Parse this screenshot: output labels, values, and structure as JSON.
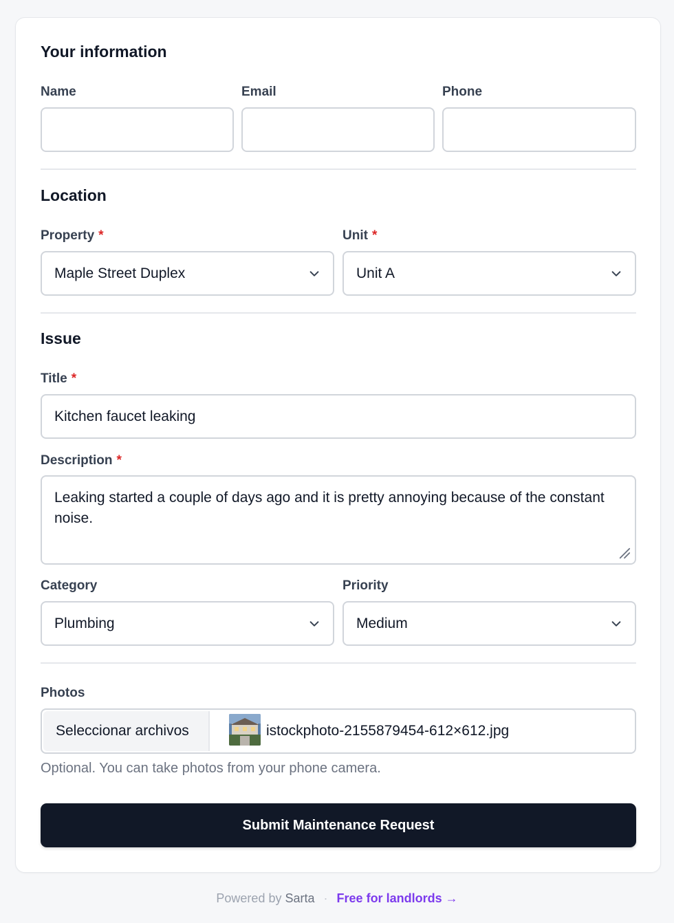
{
  "sections": {
    "your_info": "Your information",
    "location": "Location",
    "issue": "Issue"
  },
  "fields": {
    "name": {
      "label": "Name",
      "value": ""
    },
    "email": {
      "label": "Email",
      "value": ""
    },
    "phone": {
      "label": "Phone",
      "value": ""
    },
    "property": {
      "label": "Property",
      "value": "Maple Street Duplex",
      "required": "*"
    },
    "unit": {
      "label": "Unit",
      "value": "Unit A",
      "required": "*"
    },
    "title": {
      "label": "Title",
      "value": "Kitchen faucet leaking",
      "required": "*"
    },
    "description": {
      "label": "Description",
      "value": "Leaking started a couple of days ago and it is pretty annoying because of the constant noise.",
      "required": "*"
    },
    "category": {
      "label": "Category",
      "value": "Plumbing"
    },
    "priority": {
      "label": "Priority",
      "value": "Medium"
    },
    "photos": {
      "label": "Photos",
      "button": "Seleccionar archivos",
      "filename": "istockphoto-2155879454-612×612.jpg",
      "help": "Optional. You can take photos from your phone camera."
    }
  },
  "submit_label": "Submit Maintenance Request",
  "footer": {
    "powered_by": "Powered by",
    "brand": "Sarta",
    "separator": "·",
    "link": "Free for landlords →"
  },
  "colors": {
    "required": "#dc2626",
    "button_bg": "#111827",
    "link": "#7c3aed"
  }
}
